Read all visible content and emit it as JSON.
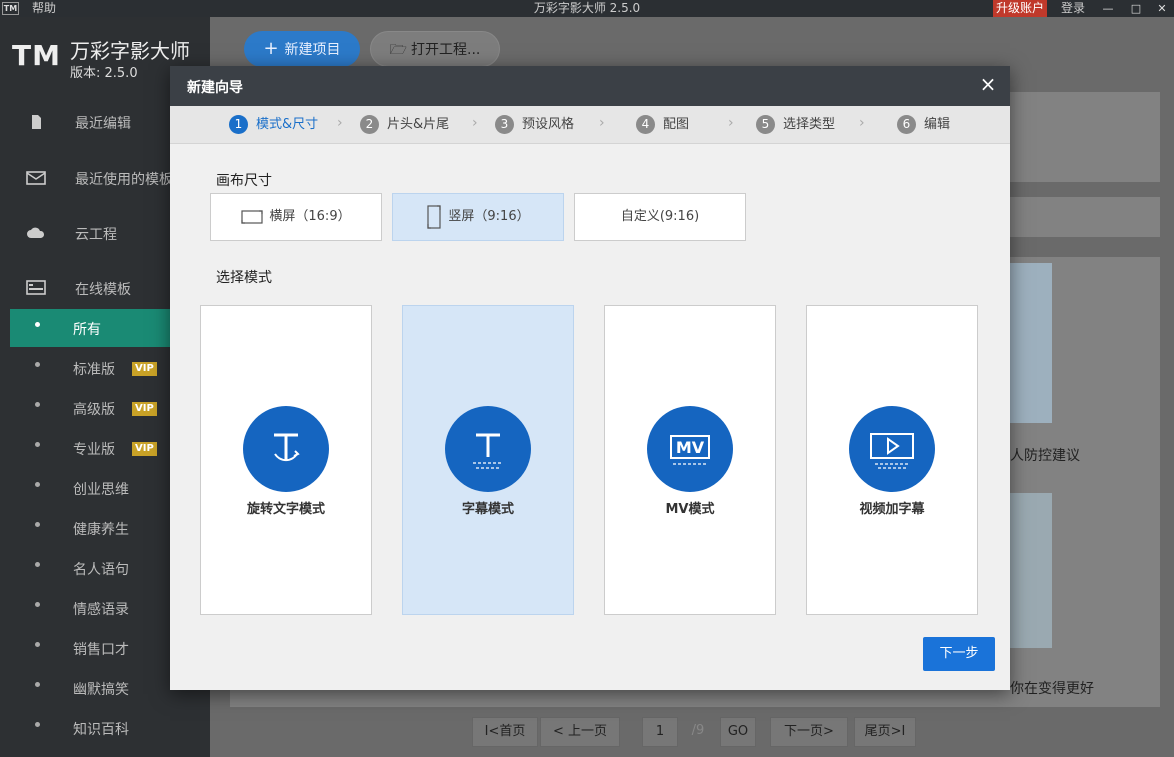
{
  "titlebar": {
    "logo": "TM",
    "help": "帮助",
    "title": "万彩字影大师 2.5.0",
    "upgrade": "升级账户",
    "login": "登录",
    "minimize": "—",
    "maximize": "□",
    "close": "✕"
  },
  "brand": {
    "logo": "TM",
    "name": "万彩字影大师",
    "version": "版本: 2.5.0"
  },
  "sidebar": {
    "nav": [
      {
        "label": "最近编辑",
        "icon": "document-icon"
      },
      {
        "label": "最近使用的模板",
        "icon": "mail-icon"
      },
      {
        "label": "云工程",
        "icon": "cloud-icon"
      },
      {
        "label": "在线模板",
        "icon": "template-icon"
      }
    ],
    "categories": [
      {
        "label": "所有",
        "vip": ""
      },
      {
        "label": "标准版",
        "vip": "VIP"
      },
      {
        "label": "高级版",
        "vip": "VIP"
      },
      {
        "label": "专业版",
        "vip": "VIP"
      },
      {
        "label": "创业思维",
        "vip": ""
      },
      {
        "label": "健康养生",
        "vip": ""
      },
      {
        "label": "名人语句",
        "vip": ""
      },
      {
        "label": "情感语录",
        "vip": ""
      },
      {
        "label": "销售口才",
        "vip": ""
      },
      {
        "label": "幽默搞笑",
        "vip": ""
      },
      {
        "label": "知识百科",
        "vip": ""
      }
    ],
    "active_index": 0
  },
  "main": {
    "new_project": "新建项目",
    "open_project": "打开工程...",
    "bg_text_1": "人防控建议",
    "bg_text_2": "你在变得更好",
    "pager": {
      "first": "首页",
      "prev": "上一页",
      "page": "1",
      "total": "/9",
      "go": "GO",
      "next": "下一页",
      "last": "尾页"
    }
  },
  "dialog": {
    "title": "新建向导",
    "close": "×",
    "steps": [
      {
        "num": "1",
        "label": "模式&尺寸"
      },
      {
        "num": "2",
        "label": "片头&片尾"
      },
      {
        "num": "3",
        "label": "预设风格"
      },
      {
        "num": "4",
        "label": "配图"
      },
      {
        "num": "5",
        "label": "选择类型"
      },
      {
        "num": "6",
        "label": "编辑"
      }
    ],
    "active_step": 0,
    "canvas_section": "画布尺寸",
    "sizes": [
      {
        "label": "横屏（16:9）",
        "icon": "landscape-icon"
      },
      {
        "label": "竖屏（9:16）",
        "icon": "portrait-icon"
      },
      {
        "label": "自定义(9:16)",
        "icon": ""
      }
    ],
    "selected_size": 1,
    "mode_section": "选择模式",
    "modes": [
      {
        "label": "旋转文字模式",
        "icon": "rotate-text-icon"
      },
      {
        "label": "字幕模式",
        "icon": "subtitle-text-icon"
      },
      {
        "label": "MV模式",
        "icon": "mv-icon"
      },
      {
        "label": "视频加字幕",
        "icon": "video-play-icon"
      }
    ],
    "selected_mode": 1,
    "next": "下一步"
  },
  "colors": {
    "accent": "#1a73d9",
    "sidebar_active": "#1a8a74",
    "selected_bg": "#d6e6f7",
    "vip": "#c9a227",
    "upgrade": "#c0392b"
  }
}
